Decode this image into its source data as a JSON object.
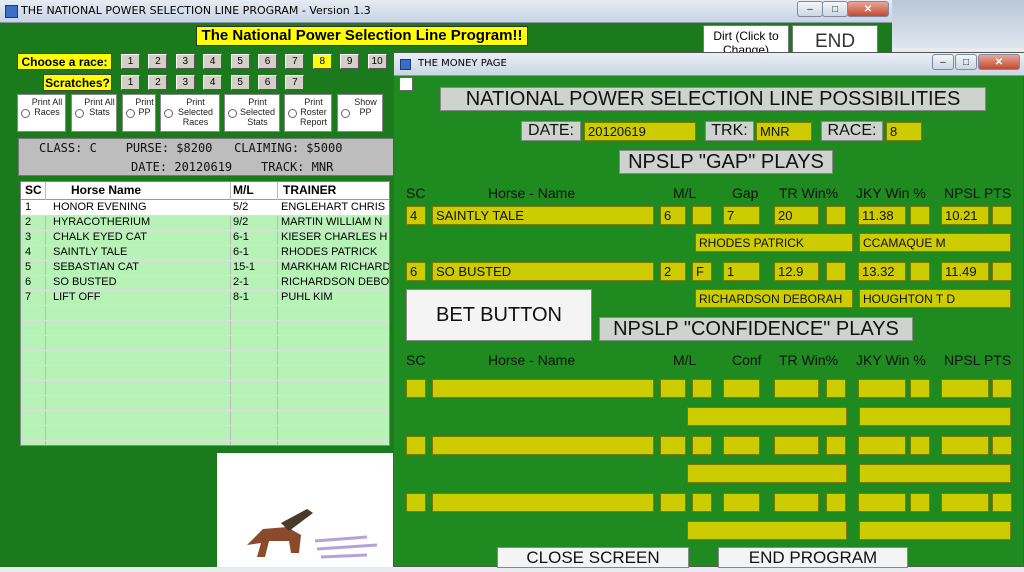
{
  "main_window": {
    "title": "THE NATIONAL POWER SELECTION LINE PROGRAM - Version 1.3",
    "banner": "The National Power Selection Line Program!!",
    "dirt_button": "Dirt (Click to Change)",
    "end_button": "END",
    "choose_race_label": "Choose  a race:",
    "race_numbers": [
      "1",
      "2",
      "3",
      "4",
      "5",
      "6",
      "7",
      "8",
      "9",
      "10"
    ],
    "selected_race": "8",
    "scratches_label": "Scratches?",
    "scratch_numbers": [
      "1",
      "2",
      "3",
      "4",
      "5",
      "6",
      "7"
    ],
    "print_options": [
      {
        "label": "Print All Races"
      },
      {
        "label": "Print All Stats"
      },
      {
        "label": "Print PP"
      },
      {
        "label": "Print Selected Races"
      },
      {
        "label": "Print Selected Stats"
      },
      {
        "label": "Print Roster Report"
      },
      {
        "label": "Show PP"
      }
    ],
    "info_line1": "CLASS: C    PURSE: $8200   CLAIMING: $5000",
    "info_line2": "DATE: 20120619    TRACK: MNR",
    "columns": [
      "SC",
      "Horse Name",
      "M/L",
      "TRAINER"
    ],
    "rows": [
      {
        "sc": "1",
        "name": "HONOR EVENING",
        "ml": "5/2",
        "trainer": "ENGLEHART CHRIS"
      },
      {
        "sc": "2",
        "name": "HYRACOTHERIUM",
        "ml": "9/2",
        "trainer": "MARTIN WILLIAM N"
      },
      {
        "sc": "3",
        "name": "CHALK EYED CAT",
        "ml": "6-1",
        "trainer": "KIESER CHARLES H"
      },
      {
        "sc": "4",
        "name": "SAINTLY TALE",
        "ml": "6-1",
        "trainer": "RHODES PATRICK"
      },
      {
        "sc": "5",
        "name": "SEBASTIAN CAT",
        "ml": "15-1",
        "trainer": "MARKHAM RICHARD"
      },
      {
        "sc": "6",
        "name": "SO BUSTED",
        "ml": "2-1",
        "trainer": "RICHARDSON DEBO"
      },
      {
        "sc": "7",
        "name": "LIFT OFF",
        "ml": "8-1",
        "trainer": "PUHL KIM"
      }
    ]
  },
  "money_page": {
    "title": "THE MONEY PAGE",
    "heading": "NATIONAL POWER SELECTION LINE POSSIBILITIES",
    "date_label": "DATE:",
    "date_value": "20120619",
    "trk_label": "TRK:",
    "trk_value": "MNR",
    "race_label": "RACE:",
    "race_value": "8",
    "gap_heading": "NPSLP \"GAP\" PLAYS",
    "gap_cols": [
      "SC",
      "Horse - Name",
      "M/L",
      "Gap",
      "TR Win%",
      "JKY Win %",
      "NPSL PTS"
    ],
    "gap_plays": [
      {
        "sc": "4",
        "name": "SAINTLY TALE",
        "ml": "6",
        "flag": "",
        "gap": "7",
        "tr_win": "20",
        "jky_win": "11.38",
        "pts": "10.21",
        "trainer": "RHODES PATRICK",
        "jockey": "CCAMAQUE M"
      },
      {
        "sc": "6",
        "name": "SO BUSTED",
        "ml": "2",
        "flag": "F",
        "gap": "1",
        "tr_win": "12.9",
        "jky_win": "13.32",
        "pts": "11.49",
        "trainer": "RICHARDSON DEBORAH",
        "jockey": "HOUGHTON T D"
      }
    ],
    "bet_button": "BET BUTTON",
    "confidence_heading": "NPSLP \"CONFIDENCE\" PLAYS",
    "conf_cols": [
      "SC",
      "Horse - Name",
      "M/L",
      "Conf",
      "TR Win%",
      "JKY Win %",
      "NPSL PTS"
    ],
    "close_button": "CLOSE SCREEN",
    "end_program_button": "END PROGRAM"
  }
}
